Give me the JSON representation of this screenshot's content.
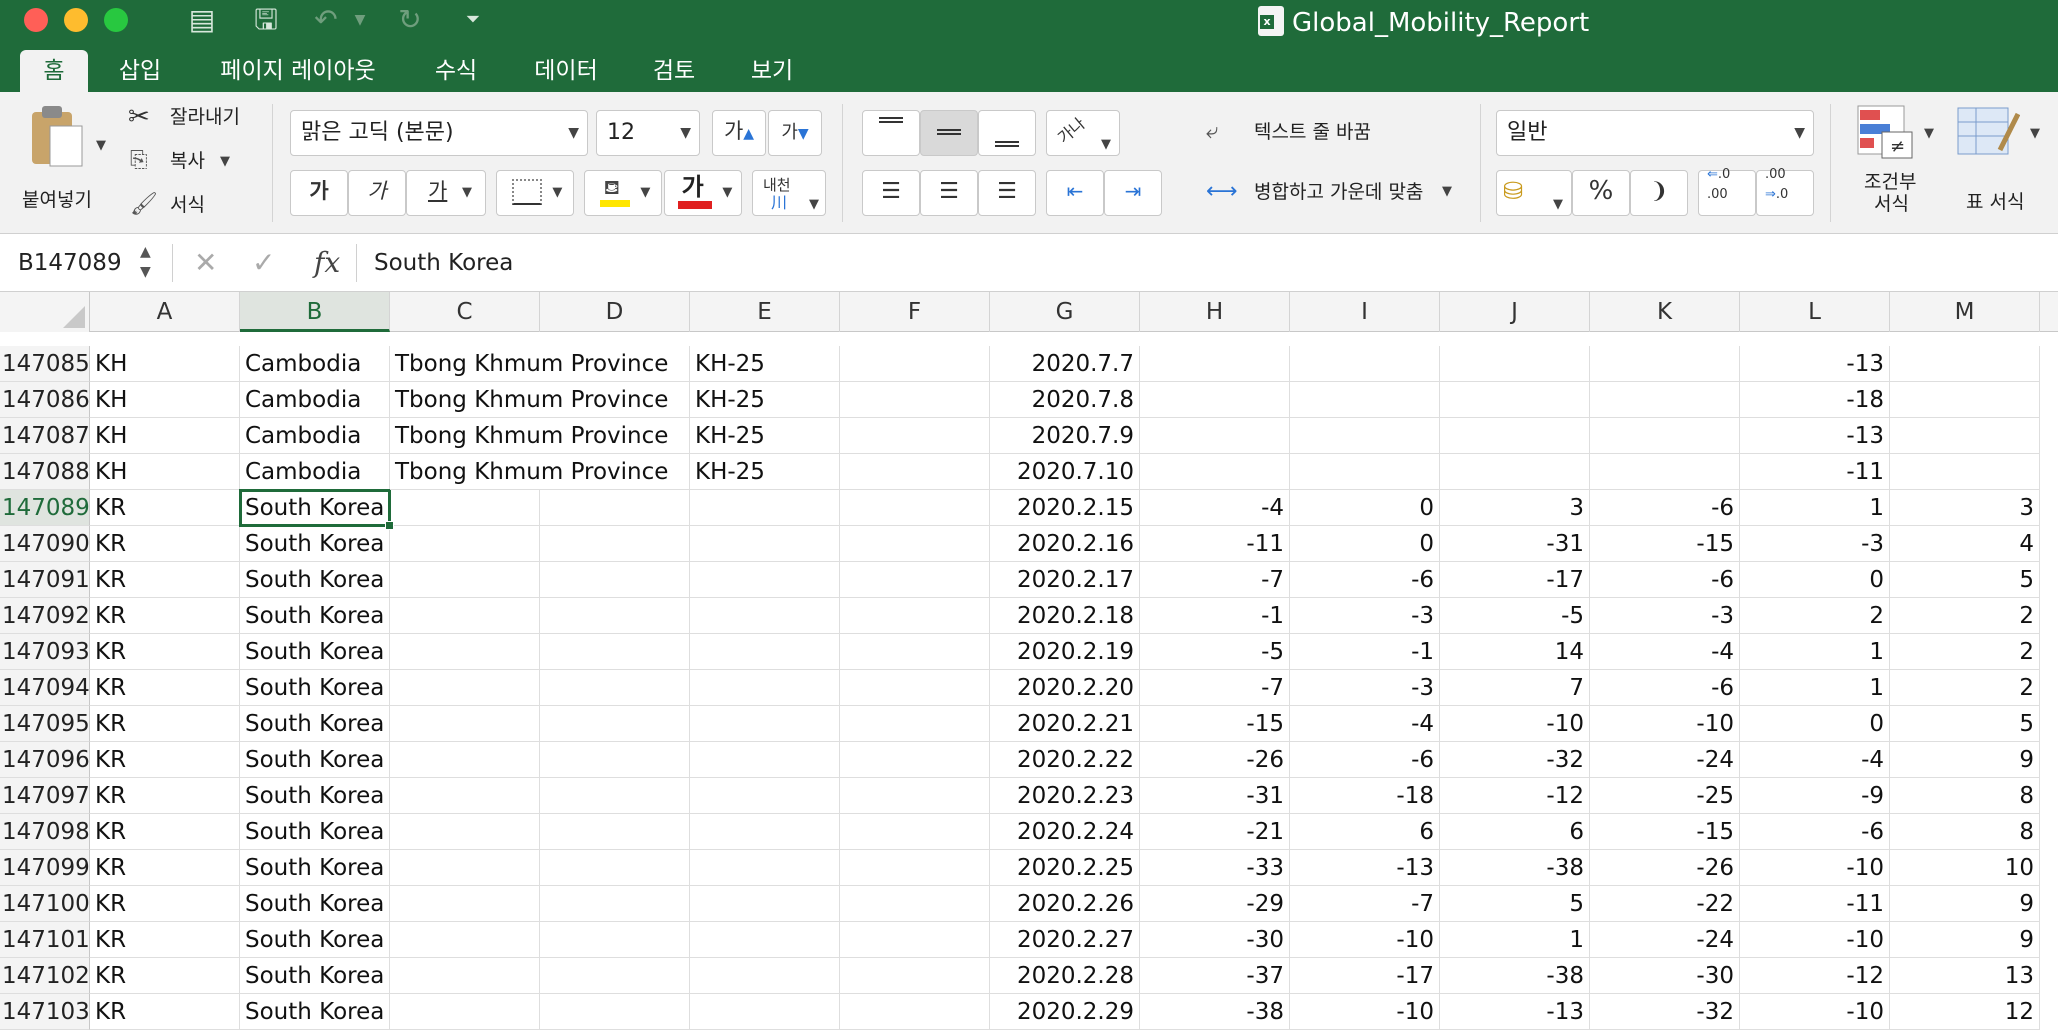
{
  "window": {
    "title": "Global_Mobility_Report",
    "file_icon": "excel-file-icon"
  },
  "quick_access": [
    "sidebar-toggle-icon",
    "save-icon",
    "undo-icon",
    "redo-icon",
    "customize-icon"
  ],
  "tabs": [
    {
      "label": "홈",
      "active": true
    },
    {
      "label": "삽입"
    },
    {
      "label": "페이지 레이아웃"
    },
    {
      "label": "수식"
    },
    {
      "label": "데이터"
    },
    {
      "label": "검토"
    },
    {
      "label": "보기"
    }
  ],
  "ribbon": {
    "paste_label": "붙여넣기",
    "cut_label": "잘라내기",
    "copy_label": "복사",
    "format_painter_label": "서식",
    "font_name": "맑은 고딕 (본문)",
    "font_size": "12",
    "font_grow": "가",
    "font_shrink": "가",
    "bold": "가",
    "italic": "가",
    "underline": "가",
    "font_color_glyph": "가",
    "phonetic_label": "내천",
    "wrap_text_label": "텍스트 줄 바꿈",
    "merge_center_label": "병합하고 가운데 맞춤",
    "number_format": "일반",
    "percent": "%",
    "comma": "❩",
    "conditional_format_label_1": "조건부",
    "conditional_format_label_2": "서식",
    "table_format_label": "표 서식",
    "accent_yellow": "#ffe600",
    "accent_red": "#e02020"
  },
  "formula_bar": {
    "name_box": "B147089",
    "fx": "fx",
    "formula": "South Korea"
  },
  "columns": [
    "A",
    "B",
    "C",
    "D",
    "E",
    "F",
    "G",
    "H",
    "I",
    "J",
    "K",
    "L",
    "M"
  ],
  "active_column": "B",
  "active_row": "147089",
  "rows": [
    {
      "num": "147085",
      "cells": [
        "KH",
        "Cambodia",
        "Tbong Khmum Province",
        "",
        "KH-25",
        "",
        "2020.7.7",
        "",
        "",
        "",
        "",
        "-13",
        ""
      ]
    },
    {
      "num": "147086",
      "cells": [
        "KH",
        "Cambodia",
        "Tbong Khmum Province",
        "",
        "KH-25",
        "",
        "2020.7.8",
        "",
        "",
        "",
        "",
        "-18",
        ""
      ]
    },
    {
      "num": "147087",
      "cells": [
        "KH",
        "Cambodia",
        "Tbong Khmum Province",
        "",
        "KH-25",
        "",
        "2020.7.9",
        "",
        "",
        "",
        "",
        "-13",
        ""
      ]
    },
    {
      "num": "147088",
      "cells": [
        "KH",
        "Cambodia",
        "Tbong Khmum Province",
        "",
        "KH-25",
        "",
        "2020.7.10",
        "",
        "",
        "",
        "",
        "-11",
        ""
      ]
    },
    {
      "num": "147089",
      "cells": [
        "KR",
        "South Korea",
        "",
        "",
        "",
        "",
        "2020.2.15",
        "-4",
        "0",
        "3",
        "-6",
        "1",
        "3"
      ]
    },
    {
      "num": "147090",
      "cells": [
        "KR",
        "South Korea",
        "",
        "",
        "",
        "",
        "2020.2.16",
        "-11",
        "0",
        "-31",
        "-15",
        "-3",
        "4"
      ]
    },
    {
      "num": "147091",
      "cells": [
        "KR",
        "South Korea",
        "",
        "",
        "",
        "",
        "2020.2.17",
        "-7",
        "-6",
        "-17",
        "-6",
        "0",
        "5"
      ]
    },
    {
      "num": "147092",
      "cells": [
        "KR",
        "South Korea",
        "",
        "",
        "",
        "",
        "2020.2.18",
        "-1",
        "-3",
        "-5",
        "-3",
        "2",
        "2"
      ]
    },
    {
      "num": "147093",
      "cells": [
        "KR",
        "South Korea",
        "",
        "",
        "",
        "",
        "2020.2.19",
        "-5",
        "-1",
        "14",
        "-4",
        "1",
        "2"
      ]
    },
    {
      "num": "147094",
      "cells": [
        "KR",
        "South Korea",
        "",
        "",
        "",
        "",
        "2020.2.20",
        "-7",
        "-3",
        "7",
        "-6",
        "1",
        "2"
      ]
    },
    {
      "num": "147095",
      "cells": [
        "KR",
        "South Korea",
        "",
        "",
        "",
        "",
        "2020.2.21",
        "-15",
        "-4",
        "-10",
        "-10",
        "0",
        "5"
      ]
    },
    {
      "num": "147096",
      "cells": [
        "KR",
        "South Korea",
        "",
        "",
        "",
        "",
        "2020.2.22",
        "-26",
        "-6",
        "-32",
        "-24",
        "-4",
        "9"
      ]
    },
    {
      "num": "147097",
      "cells": [
        "KR",
        "South Korea",
        "",
        "",
        "",
        "",
        "2020.2.23",
        "-31",
        "-18",
        "-12",
        "-25",
        "-9",
        "8"
      ]
    },
    {
      "num": "147098",
      "cells": [
        "KR",
        "South Korea",
        "",
        "",
        "",
        "",
        "2020.2.24",
        "-21",
        "6",
        "6",
        "-15",
        "-6",
        "8"
      ]
    },
    {
      "num": "147099",
      "cells": [
        "KR",
        "South Korea",
        "",
        "",
        "",
        "",
        "2020.2.25",
        "-33",
        "-13",
        "-38",
        "-26",
        "-10",
        "10"
      ]
    },
    {
      "num": "147100",
      "cells": [
        "KR",
        "South Korea",
        "",
        "",
        "",
        "",
        "2020.2.26",
        "-29",
        "-7",
        "5",
        "-22",
        "-11",
        "9"
      ]
    },
    {
      "num": "147101",
      "cells": [
        "KR",
        "South Korea",
        "",
        "",
        "",
        "",
        "2020.2.27",
        "-30",
        "-10",
        "1",
        "-24",
        "-10",
        "9"
      ]
    },
    {
      "num": "147102",
      "cells": [
        "KR",
        "South Korea",
        "",
        "",
        "",
        "",
        "2020.2.28",
        "-37",
        "-17",
        "-38",
        "-30",
        "-12",
        "13"
      ]
    },
    {
      "num": "147103",
      "cells": [
        "KR",
        "South Korea",
        "",
        "",
        "",
        "",
        "2020.2.29",
        "-38",
        "-10",
        "-13",
        "-32",
        "-10",
        "12"
      ]
    }
  ]
}
